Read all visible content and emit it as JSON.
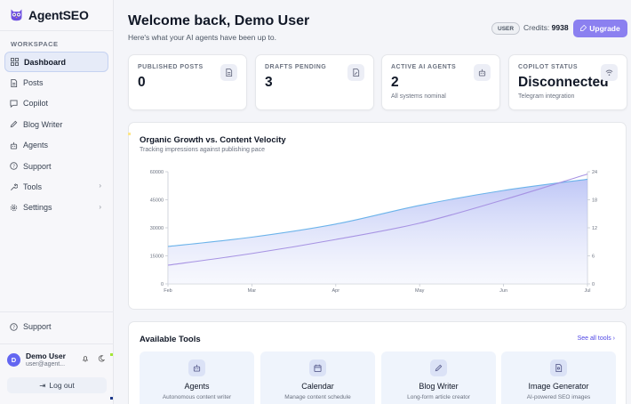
{
  "brand": {
    "name": "AgentSEO",
    "logo_icon": "owl-logo-icon",
    "accent": "#6d4fe0"
  },
  "sidebar": {
    "section_label": "WORKSPACE",
    "items": [
      {
        "label": "Dashboard",
        "icon": "grid-icon",
        "active": true
      },
      {
        "label": "Posts",
        "icon": "document-icon"
      },
      {
        "label": "Copilot",
        "icon": "chat-icon"
      },
      {
        "label": "Blog Writer",
        "icon": "pen-icon"
      },
      {
        "label": "Agents",
        "icon": "robot-icon"
      },
      {
        "label": "Support",
        "icon": "help-icon"
      },
      {
        "label": "Tools",
        "icon": "wrench-icon",
        "chevron": "›"
      },
      {
        "label": "Settings",
        "icon": "gear-icon",
        "chevron": "›"
      }
    ],
    "support_bottom": "Support",
    "user": {
      "initial": "D",
      "name": "Demo User",
      "email": "user@agent..."
    },
    "logout_label": "Log out",
    "logout_icon": "⇥"
  },
  "header": {
    "title": "Welcome back, Demo User",
    "subtitle": "Here's what your AI agents have been up to.",
    "role_badge": "USER",
    "credits_label": "Credits:",
    "credits_value": "9938",
    "upgrade_label": "Upgrade",
    "upgrade_color": "#8b80f0"
  },
  "stats": [
    {
      "label": "PUBLISHED POSTS",
      "value": "0",
      "sub": "",
      "icon": "document-icon"
    },
    {
      "label": "DRAFTS PENDING",
      "value": "3",
      "sub": "",
      "icon": "document-edit-icon"
    },
    {
      "label": "ACTIVE AI AGENTS",
      "value": "2",
      "sub": "All systems nominal",
      "icon": "robot-icon"
    },
    {
      "label": "COPILOT STATUS",
      "value": "Disconnected",
      "sub": "Telegram integration",
      "icon": "wifi-icon"
    }
  ],
  "chart": {
    "title": "Organic Growth vs. Content Velocity",
    "subtitle": "Tracking impressions against publishing pace"
  },
  "chart_data": {
    "type": "area",
    "categories": [
      "Feb",
      "Mar",
      "Apr",
      "May",
      "Jun",
      "Jul"
    ],
    "left_axis": {
      "ticks": [
        "60000",
        "45000",
        "30000",
        "15000",
        "0"
      ],
      "ylim": [
        0,
        60000
      ]
    },
    "right_axis": {
      "ticks": [
        "24",
        "18",
        "12",
        "6",
        "0"
      ],
      "ylim": [
        0,
        24
      ]
    },
    "series": [
      {
        "axis": "left",
        "color": "#6bb3ea",
        "fill": true,
        "values": [
          20000,
          25000,
          32000,
          42000,
          50000,
          56000
        ]
      },
      {
        "axis": "right",
        "color": "#a793e3",
        "fill": false,
        "values": [
          4,
          6.5,
          9.5,
          13,
          18,
          23.5
        ]
      }
    ],
    "grid": false,
    "legend": "none"
  },
  "tools": {
    "title": "Available Tools",
    "see_all": "See all tools  ›",
    "items": [
      {
        "name": "Agents",
        "desc": "Autonomous content writer",
        "icon": "robot-icon"
      },
      {
        "name": "Calendar",
        "desc": "Manage content schedule",
        "icon": "calendar-icon"
      },
      {
        "name": "Blog Writer",
        "desc": "Long-form article creator",
        "icon": "pen-icon"
      },
      {
        "name": "Image Generator",
        "desc": "AI-powered SEO images",
        "icon": "image-icon"
      }
    ]
  }
}
